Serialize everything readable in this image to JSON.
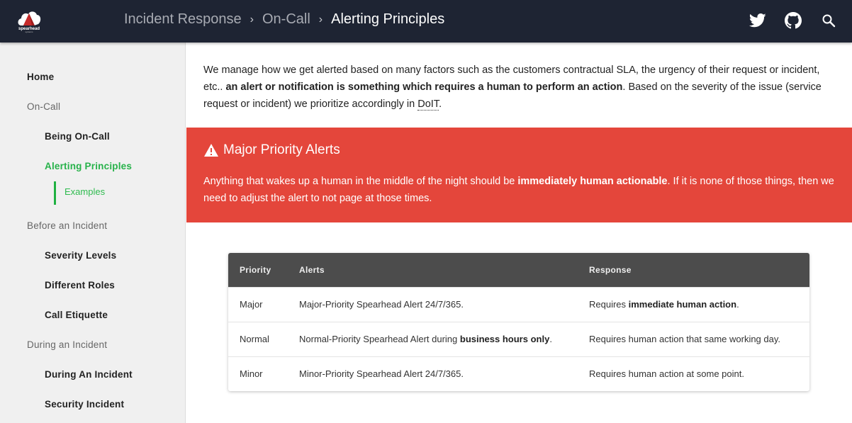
{
  "header": {
    "logo_text": "spearhead",
    "logo_subtext": "systems",
    "breadcrumb": [
      "Incident Response",
      "On-Call",
      "Alerting Principles"
    ],
    "breadcrumb_separator": "›",
    "icons": [
      "twitter-icon",
      "github-icon",
      "search-icon"
    ]
  },
  "sidebar": {
    "items": [
      {
        "label": "Home",
        "level": 0,
        "type": "link"
      },
      {
        "label": "On-Call",
        "level": 0,
        "type": "section"
      },
      {
        "label": "Being On-Call",
        "level": 1,
        "type": "link"
      },
      {
        "label": "Alerting Principles",
        "level": 1,
        "type": "link",
        "active": true
      },
      {
        "label": "Examples",
        "level": 2,
        "type": "anchor"
      },
      {
        "label": "Before an Incident",
        "level": 0,
        "type": "section"
      },
      {
        "label": "Severity Levels",
        "level": 1,
        "type": "link"
      },
      {
        "label": "Different Roles",
        "level": 1,
        "type": "link"
      },
      {
        "label": "Call Etiquette",
        "level": 1,
        "type": "link"
      },
      {
        "label": "During an Incident",
        "level": 0,
        "type": "section"
      },
      {
        "label": "During An Incident",
        "level": 1,
        "type": "link"
      },
      {
        "label": "Security Incident",
        "level": 1,
        "type": "link"
      }
    ]
  },
  "intro": {
    "text_1": "We manage how we get alerted based on many factors such as the customers contractual SLA, the urgency of their request or incident, etc.. ",
    "bold": "an alert or notification is something which requires a human to perform an action",
    "text_2": ". Based on the severity of the issue (service request or incident) we prioritize accordingly in ",
    "link": "DoIT",
    "text_3": "."
  },
  "alert": {
    "title": "Major Priority Alerts",
    "text_1": "Anything that wakes up a human in the middle of the night should be ",
    "bold": "immediately human actionable",
    "text_2": ". If it is none of those things, then we need to adjust the alert to not page at those times."
  },
  "table": {
    "headers": [
      "Priority",
      "Alerts",
      "Response"
    ],
    "rows": [
      {
        "priority": "Major",
        "alerts": {
          "text": "Major-Priority Spearhead Alert 24/7/365.",
          "bold": "",
          "suffix": ""
        },
        "response": {
          "text": "Requires ",
          "bold": "immediate human action",
          "suffix": "."
        }
      },
      {
        "priority": "Normal",
        "alerts": {
          "text": "Normal-Priority Spearhead Alert during ",
          "bold": "business hours only",
          "suffix": "."
        },
        "response": {
          "text": "Requires human action that same working day.",
          "bold": "",
          "suffix": ""
        }
      },
      {
        "priority": "Minor",
        "alerts": {
          "text": "Minor-Priority Spearhead Alert 24/7/365.",
          "bold": "",
          "suffix": ""
        },
        "response": {
          "text": "Requires human action at some point.",
          "bold": "",
          "suffix": ""
        }
      }
    ]
  },
  "colors": {
    "topbar": "#1e2433",
    "accent_green": "#27b24a",
    "alert_red": "#e4463b",
    "table_header": "#4c4c4c"
  }
}
